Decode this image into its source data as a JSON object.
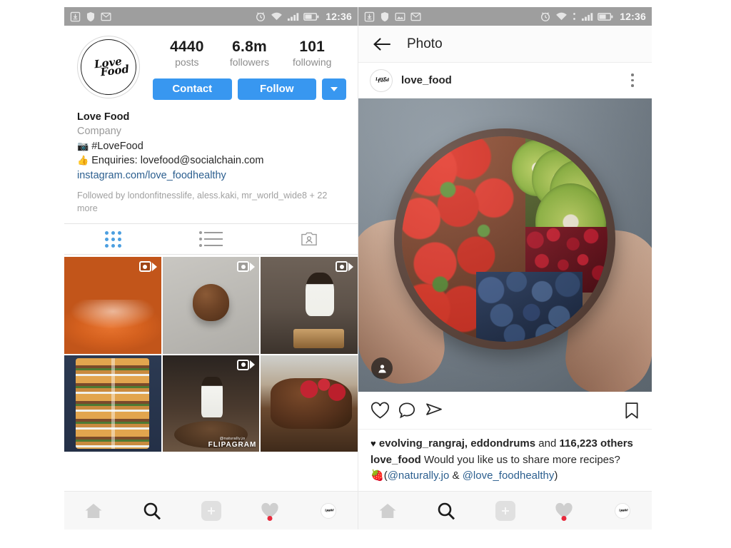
{
  "statusbar": {
    "time": "12:36",
    "left_icons": [
      "download-icon",
      "shield-icon",
      "gmail-icon"
    ],
    "right_icons": [
      "alarm-icon",
      "wifi-icon",
      "signal-icon",
      "battery-icon"
    ]
  },
  "profile": {
    "avatar_logo_line1": "Love",
    "avatar_logo_line2": "Food",
    "stats": [
      {
        "value": "4440",
        "label": "posts"
      },
      {
        "value": "6.8m",
        "label": "followers"
      },
      {
        "value": "101",
        "label": "following"
      }
    ],
    "contact_label": "Contact",
    "follow_label": "Follow",
    "more_icon": "chevron-down-icon",
    "bio": {
      "name": "Love Food",
      "category": "Company",
      "line1_emoji": "📷",
      "line1_text": "#LoveFood",
      "line2_emoji": "👍",
      "line2_text": "Enquiries: lovefood@socialchain.com",
      "link": "instagram.com/love_foodhealthy"
    },
    "followed_by": "Followed by londonfitnesslife, aless.kaki, mr_world_wide8 + 22 more",
    "tabs": [
      {
        "name": "grid-tab",
        "icon": "grid-icon",
        "active": true
      },
      {
        "name": "list-tab",
        "icon": "list-icon",
        "active": false
      },
      {
        "name": "tagged-tab",
        "icon": "tagged-person-icon",
        "active": false
      }
    ],
    "grid_posts": [
      {
        "name": "post-cheesecake-cafe",
        "art": "art-cake",
        "multi": true,
        "watermark": ""
      },
      {
        "name": "post-chocolate-dome",
        "art": "art-dome",
        "multi": true,
        "watermark": ""
      },
      {
        "name": "post-chef-slicing",
        "art": "art-chef",
        "multi": true,
        "watermark": ""
      },
      {
        "name": "post-burger-stack",
        "art": "art-burger",
        "multi": false,
        "watermark": ""
      },
      {
        "name": "post-flipagram-video",
        "art": "art-flip",
        "multi": true,
        "watermark": "FLIPAGRAM",
        "watermark_small": "@naturally.jo"
      },
      {
        "name": "post-chocolate-raspberry",
        "art": "art-choc",
        "multi": false,
        "watermark": ""
      }
    ]
  },
  "photo_screen": {
    "appbar_title": "Photo",
    "back_icon": "back-arrow-icon",
    "username": "love_food",
    "menu_icon": "kebab-menu-icon",
    "photo_alt": "hands holding bowl of strawberries kiwi pomegranate blueberries",
    "tag_badge_icon": "tagged-person-icon",
    "actions": [
      {
        "name": "like-button",
        "icon": "heart-icon"
      },
      {
        "name": "comment-button",
        "icon": "speech-bubble-icon"
      },
      {
        "name": "share-button",
        "icon": "paper-plane-icon"
      },
      {
        "name": "save-button",
        "icon": "bookmark-icon"
      }
    ],
    "likes_heart": "♥",
    "likes_user1": "evolving_rangraj,",
    "likes_user2": "eddondrums",
    "likes_and": "and",
    "likes_count": "116,223 others",
    "caption_user": "love_food",
    "caption_text": "Would you like us to share more recipes?",
    "caption_emoji": "🍓",
    "caption_credit_open": "(",
    "caption_mention1": "@naturally.jo",
    "caption_amp": "&",
    "caption_mention2": "@love_foodhealthy",
    "caption_credit_close": ")"
  },
  "bottom_nav": [
    {
      "name": "nav-home",
      "icon": "home-icon",
      "active": false
    },
    {
      "name": "nav-search",
      "icon": "search-icon",
      "active": true
    },
    {
      "name": "nav-add",
      "icon": "plus-icon",
      "active": false
    },
    {
      "name": "nav-activity",
      "icon": "heart-icon",
      "active": false,
      "badge": true
    },
    {
      "name": "nav-profile",
      "icon": "avatar-icon",
      "active": false
    }
  ],
  "colors": {
    "accent_blue": "#3897f0",
    "link_blue": "#2c5f8f",
    "statusbar_grey": "#9e9e9e",
    "notification_red": "#e8293c",
    "text_primary": "#262626",
    "text_muted": "#9a9a9a"
  }
}
